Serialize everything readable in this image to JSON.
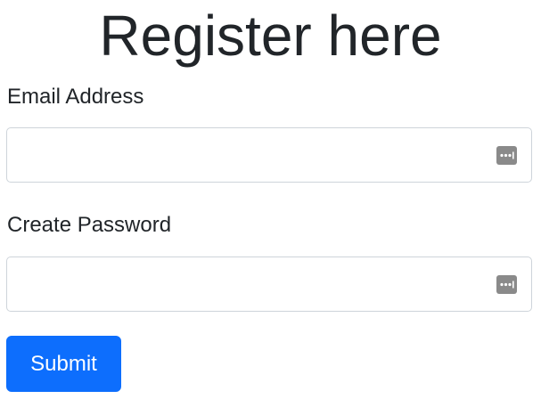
{
  "page": {
    "title": "Register here"
  },
  "form": {
    "email": {
      "label": "Email Address",
      "value": "",
      "placeholder": "",
      "autofill_icon": "password-autofill-key-icon"
    },
    "password": {
      "label": "Create Password",
      "value": "",
      "placeholder": "",
      "autofill_icon": "password-autofill-key-icon"
    },
    "submit_label": "Submit"
  },
  "colors": {
    "primary": "#0d6efd",
    "text": "#212529",
    "input_border": "#ced4da",
    "autofill_icon": "#8a8a8a"
  }
}
